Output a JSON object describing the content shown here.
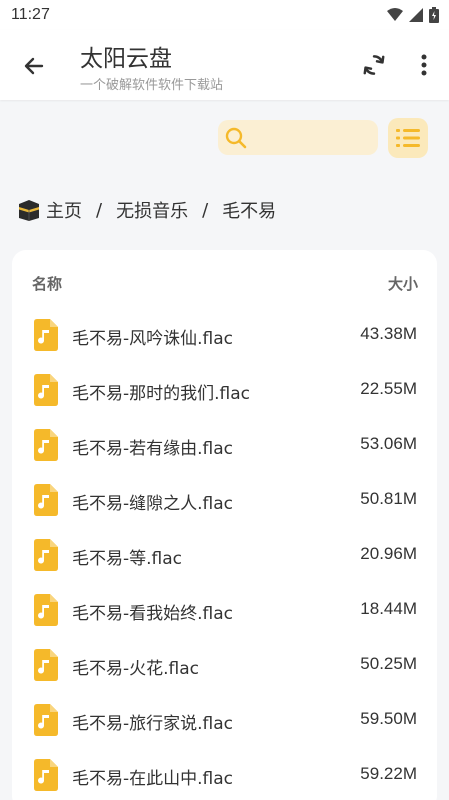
{
  "status_bar": {
    "time": "11:27"
  },
  "app_bar": {
    "title": "太阳云盘",
    "subtitle": "一个破解软件软件下载站"
  },
  "search": {
    "value": "",
    "placeholder": ""
  },
  "breadcrumb": {
    "home": "主页",
    "sep": "/",
    "folder1": "无损音乐",
    "folder2": "毛不易"
  },
  "table": {
    "col_name": "名称",
    "col_size": "大小",
    "rows": [
      {
        "name": "毛不易-风吟诛仙.flac",
        "size": "43.38M"
      },
      {
        "name": "毛不易-那时的我们.flac",
        "size": "22.55M"
      },
      {
        "name": "毛不易-若有缘由.flac",
        "size": "53.06M"
      },
      {
        "name": "毛不易-缝隙之人.flac",
        "size": "50.81M"
      },
      {
        "name": "毛不易-等.flac",
        "size": "20.96M"
      },
      {
        "name": "毛不易-看我始终.flac",
        "size": "18.44M"
      },
      {
        "name": "毛不易-火花.flac",
        "size": "50.25M"
      },
      {
        "name": "毛不易-旅行家说.flac",
        "size": "59.50M"
      },
      {
        "name": "毛不易-在此山中.flac",
        "size": "59.22M"
      }
    ]
  },
  "icons": {
    "back": "arrow-left-icon",
    "refresh": "refresh-icon",
    "more": "more-vert-icon",
    "search": "search-icon",
    "list": "list-icon",
    "home": "kaaba-icon",
    "file": "music-file-icon"
  },
  "colors": {
    "accent": "#f5b92a",
    "search_bg": "#fbefd3",
    "toggle_bg": "#fbe9bb"
  }
}
